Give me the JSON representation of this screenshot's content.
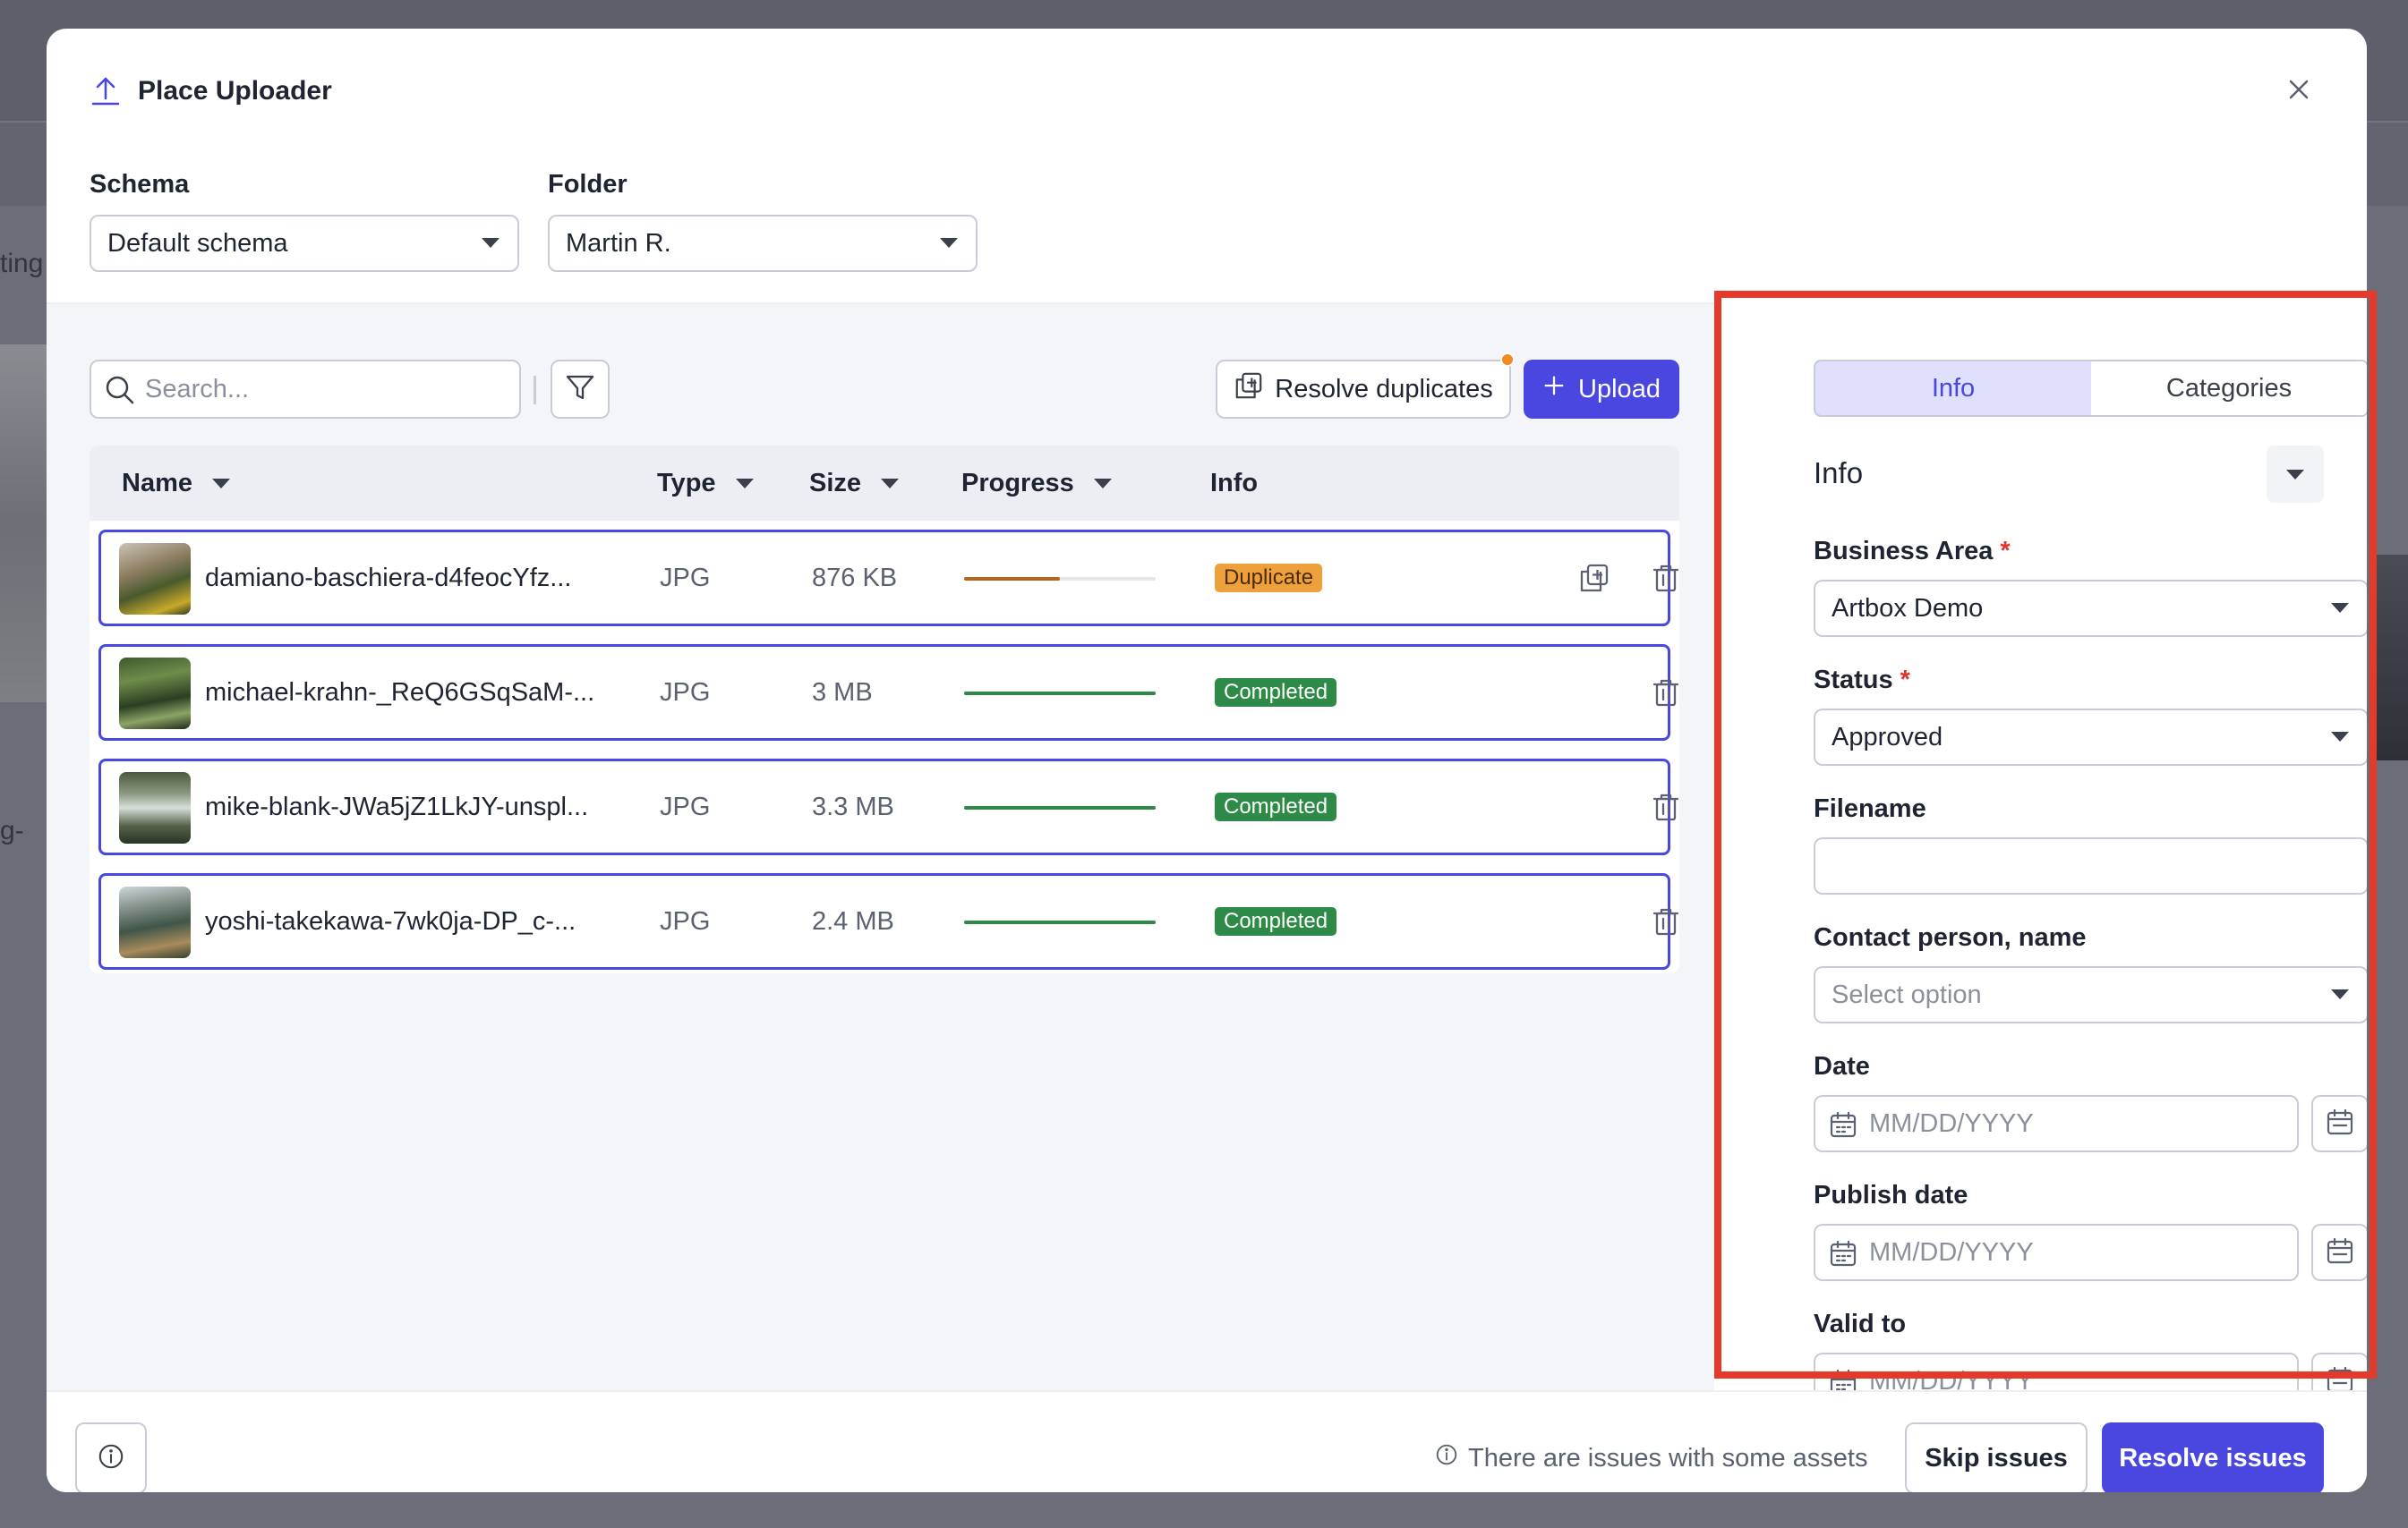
{
  "app": {
    "title": "Place Uploader"
  },
  "background": {
    "text1": "ting",
    "text2": "g-"
  },
  "filters": {
    "schema_label": "Schema",
    "schema_value": "Default schema",
    "folder_label": "Folder",
    "folder_value": "Martin R."
  },
  "toolbar": {
    "search_placeholder": "Search...",
    "resolve_duplicates_label": "Resolve duplicates",
    "upload_label": "Upload"
  },
  "table": {
    "columns": [
      "Name",
      "Type",
      "Size",
      "Progress",
      "Info"
    ],
    "rows": [
      {
        "name": "damiano-baschiera-d4feocYfz...",
        "type": "JPG",
        "size": "876 KB",
        "progress": 0.5,
        "status": "Duplicate",
        "status_color": "#eea13a",
        "progress_color": "#b5651d"
      },
      {
        "name": "michael-krahn-_ReQ6GSqSaM-...",
        "type": "JPG",
        "size": "3 MB",
        "progress": 1.0,
        "status": "Completed",
        "status_color": "#2e8b47",
        "progress_color": "#2e8b47"
      },
      {
        "name": "mike-blank-JWa5jZ1LkJY-unspl...",
        "type": "JPG",
        "size": "3.3 MB",
        "progress": 1.0,
        "status": "Completed",
        "status_color": "#2e8b47",
        "progress_color": "#2e8b47"
      },
      {
        "name": "yoshi-takekawa-7wk0ja-DP_c-...",
        "type": "JPG",
        "size": "2.4 MB",
        "progress": 1.0,
        "status": "Completed",
        "status_color": "#2e8b47",
        "progress_color": "#2e8b47"
      }
    ]
  },
  "side_panel": {
    "tabs": [
      "Info",
      "Categories"
    ],
    "active_tab": "Info",
    "section_title": "Info",
    "fields": {
      "business_area_label": "Business Area",
      "business_area_value": "Artbox Demo",
      "status_label": "Status",
      "status_value": "Approved",
      "filename_label": "Filename",
      "filename_value": "",
      "contact_label": "Contact person, name",
      "contact_placeholder": "Select option",
      "date_label": "Date",
      "date_placeholder": "MM/DD/YYYY",
      "publish_date_label": "Publish date",
      "publish_date_placeholder": "MM/DD/YYYY",
      "valid_to_label": "Valid to",
      "valid_to_placeholder": "MM/DD/YYYY"
    },
    "required_mark": "*"
  },
  "footer": {
    "issues_text": "There are issues with some assets",
    "skip_label": "Skip issues",
    "resolve_label": "Resolve issues"
  },
  "colors": {
    "accent": "#4a46e0",
    "highlight": "#e5392a",
    "duplicate": "#eea13a",
    "completed": "#2e8b47"
  },
  "icons": {
    "title": "upload-icon",
    "close": "close-icon",
    "search": "search-icon",
    "filter": "filter-icon",
    "duplicates": "duplicate-icon",
    "upload": "plus-icon",
    "delete": "trash-icon",
    "calendar": "calendar-icon",
    "info": "info-icon"
  }
}
